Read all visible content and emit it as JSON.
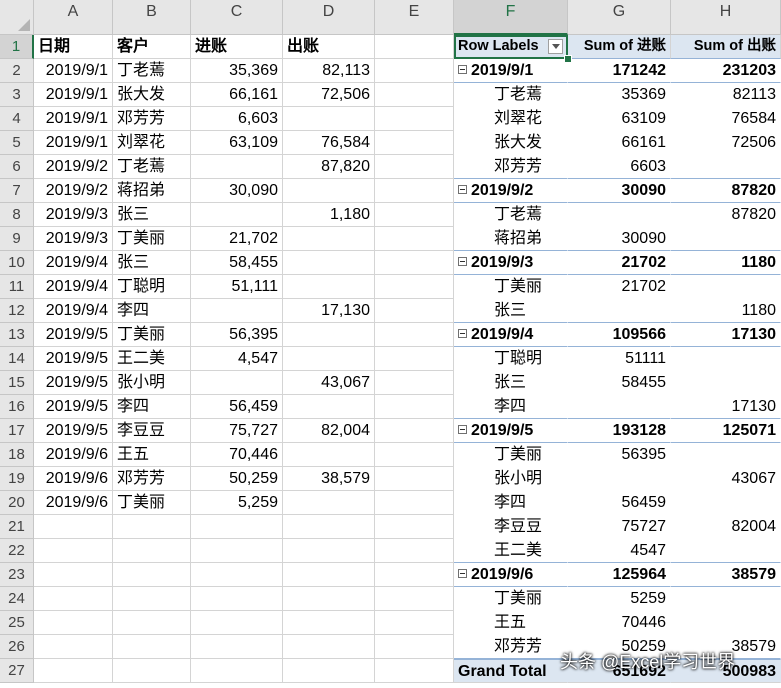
{
  "column_headers": [
    "A",
    "B",
    "C",
    "D",
    "E",
    "F",
    "G",
    "H"
  ],
  "selected_column": "F",
  "selected_row": 1,
  "row_numbers": [
    1,
    2,
    3,
    4,
    5,
    6,
    7,
    8,
    9,
    10,
    11,
    12,
    13,
    14,
    15,
    16,
    17,
    18,
    19,
    20,
    21,
    22,
    23,
    24,
    25,
    26,
    27
  ],
  "source_table": {
    "headers": [
      "日期",
      "客户",
      "进账",
      "出账"
    ],
    "rows": [
      [
        "2019/9/1",
        "丁老蔫",
        "35,369",
        "82,113"
      ],
      [
        "2019/9/1",
        "张大发",
        "66,161",
        "72,506"
      ],
      [
        "2019/9/1",
        "邓芳芳",
        "6,603",
        ""
      ],
      [
        "2019/9/1",
        "刘翠花",
        "63,109",
        "76,584"
      ],
      [
        "2019/9/2",
        "丁老蔫",
        "",
        "87,820"
      ],
      [
        "2019/9/2",
        "蒋招弟",
        "30,090",
        ""
      ],
      [
        "2019/9/3",
        "张三",
        "",
        "1,180"
      ],
      [
        "2019/9/3",
        "丁美丽",
        "21,702",
        ""
      ],
      [
        "2019/9/4",
        "张三",
        "58,455",
        ""
      ],
      [
        "2019/9/4",
        "丁聪明",
        "51,111",
        ""
      ],
      [
        "2019/9/4",
        "李四",
        "",
        "17,130"
      ],
      [
        "2019/9/5",
        "丁美丽",
        "56,395",
        ""
      ],
      [
        "2019/9/5",
        "王二美",
        "4,547",
        ""
      ],
      [
        "2019/9/5",
        "张小明",
        "",
        "43,067"
      ],
      [
        "2019/9/5",
        "李四",
        "56,459",
        ""
      ],
      [
        "2019/9/5",
        "李豆豆",
        "75,727",
        "82,004"
      ],
      [
        "2019/9/6",
        "王五",
        "70,446",
        ""
      ],
      [
        "2019/9/6",
        "邓芳芳",
        "50,259",
        "38,579"
      ],
      [
        "2019/9/6",
        "丁美丽",
        "5,259",
        ""
      ]
    ]
  },
  "pivot": {
    "header": [
      "Row Labels",
      "Sum of 进账",
      "Sum of 出账"
    ],
    "rows": [
      {
        "type": "date",
        "label": "2019/9/1",
        "in": "171242",
        "out": "231203"
      },
      {
        "type": "cust",
        "label": "丁老蔫",
        "in": "35369",
        "out": "82113"
      },
      {
        "type": "cust",
        "label": "刘翠花",
        "in": "63109",
        "out": "76584"
      },
      {
        "type": "cust",
        "label": "张大发",
        "in": "66161",
        "out": "72506"
      },
      {
        "type": "cust",
        "label": "邓芳芳",
        "in": "6603",
        "out": ""
      },
      {
        "type": "date",
        "label": "2019/9/2",
        "in": "30090",
        "out": "87820"
      },
      {
        "type": "cust",
        "label": "丁老蔫",
        "in": "",
        "out": "87820"
      },
      {
        "type": "cust",
        "label": "蒋招弟",
        "in": "30090",
        "out": ""
      },
      {
        "type": "date",
        "label": "2019/9/3",
        "in": "21702",
        "out": "1180"
      },
      {
        "type": "cust",
        "label": "丁美丽",
        "in": "21702",
        "out": ""
      },
      {
        "type": "cust",
        "label": "张三",
        "in": "",
        "out": "1180"
      },
      {
        "type": "date",
        "label": "2019/9/4",
        "in": "109566",
        "out": "17130"
      },
      {
        "type": "cust",
        "label": "丁聪明",
        "in": "51111",
        "out": ""
      },
      {
        "type": "cust",
        "label": "张三",
        "in": "58455",
        "out": ""
      },
      {
        "type": "cust",
        "label": "李四",
        "in": "",
        "out": "17130"
      },
      {
        "type": "date",
        "label": "2019/9/5",
        "in": "193128",
        "out": "125071"
      },
      {
        "type": "cust",
        "label": "丁美丽",
        "in": "56395",
        "out": ""
      },
      {
        "type": "cust",
        "label": "张小明",
        "in": "",
        "out": "43067"
      },
      {
        "type": "cust",
        "label": "李四",
        "in": "56459",
        "out": ""
      },
      {
        "type": "cust",
        "label": "李豆豆",
        "in": "75727",
        "out": "82004"
      },
      {
        "type": "cust",
        "label": "王二美",
        "in": "4547",
        "out": ""
      },
      {
        "type": "date",
        "label": "2019/9/6",
        "in": "125964",
        "out": "38579"
      },
      {
        "type": "cust",
        "label": "丁美丽",
        "in": "5259",
        "out": ""
      },
      {
        "type": "cust",
        "label": "王五",
        "in": "70446",
        "out": ""
      },
      {
        "type": "cust",
        "label": "邓芳芳",
        "in": "50259",
        "out": "38579"
      },
      {
        "type": "total",
        "label": "Grand Total",
        "in": "651692",
        "out": "500983"
      }
    ]
  },
  "watermark": "头条 @Excel学习世界",
  "colors": {
    "header_bg": "#e6e6e6",
    "selected_accent": "#217346",
    "pivot_header_bg": "#dce6f1",
    "pivot_border": "#95b3d7",
    "gridline": "#d4d4d4"
  }
}
